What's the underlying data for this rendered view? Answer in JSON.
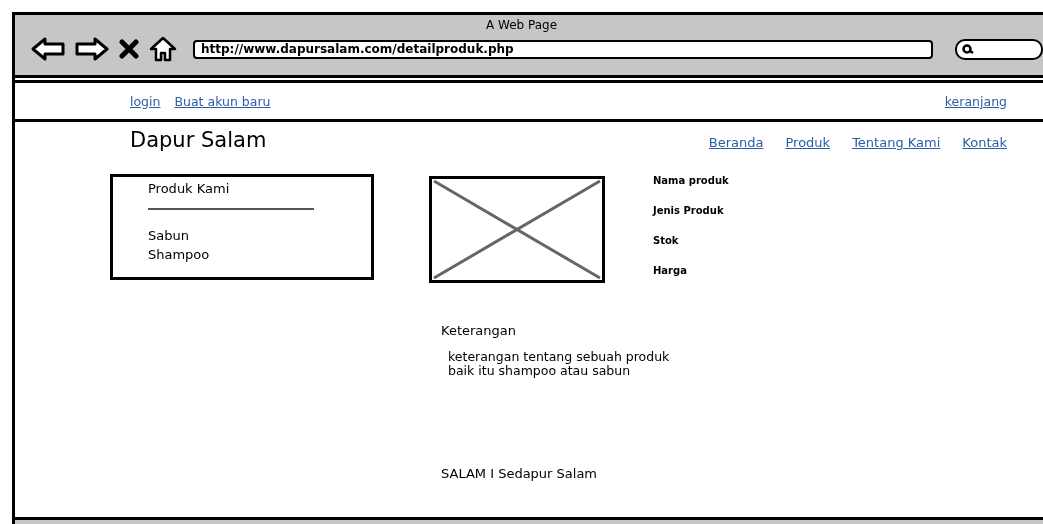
{
  "browser": {
    "title": "A Web Page",
    "url": "http://www.dapursalam.com/detailproduk.php"
  },
  "top_links": [
    "login",
    "Buat akun baru"
  ],
  "cart_link": "keranjang",
  "site_title": "Dapur Salam",
  "nav": [
    "Beranda",
    "Produk",
    "Tentang Kami",
    "Kontak"
  ],
  "sidebar": {
    "heading": "Produk Kami",
    "items": [
      "Sabun",
      "Shampoo"
    ]
  },
  "product_fields": [
    "Nama produk",
    "Jenis Produk",
    "Stok",
    "Harga"
  ],
  "description": {
    "heading": "Keterangan",
    "text": "keterangan tentang sebuah produk baik itu shampoo atau sabun"
  },
  "footer": "SALAM I Sedapur Salam"
}
